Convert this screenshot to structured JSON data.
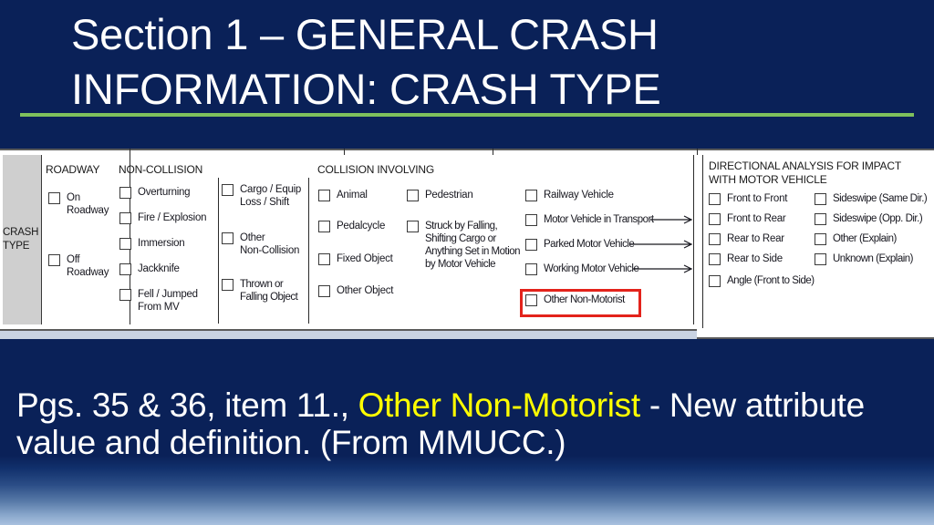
{
  "slide": {
    "background_color": "#0a2158",
    "accent_rule_color": "#7fc15c",
    "highlight_color": "#ffff00",
    "red_box_color": "#e3231b"
  },
  "title": {
    "text": "Section 1 – GENERAL CRASH\nINFORMATION: CRASH TYPE"
  },
  "form": {
    "row_label": "CRASH\nTYPE",
    "sections": {
      "roadway": {
        "heading": "ROADWAY",
        "options": [
          "On\nRoadway",
          "Off\nRoadway"
        ]
      },
      "non_collision": {
        "heading": "NON-COLLISION",
        "options_col1": [
          "Overturning",
          "Fire / Explosion",
          "Immersion",
          "Jackknife",
          "Fell / Jumped\nFrom MV"
        ],
        "options_col2": [
          "Cargo / Equip\nLoss / Shift",
          "Other\nNon-Collision",
          "Thrown or\nFalling Object"
        ]
      },
      "collision_involving": {
        "heading": "COLLISION INVOLVING",
        "options_col1": [
          "Animal",
          "Pedalcycle",
          "Fixed Object",
          "Other Object"
        ],
        "options_col2": [
          "Pedestrian",
          "Struck by Falling,\nShifting Cargo or\nAnything Set in Motion\nby Motor Vehicle"
        ],
        "options_col3": [
          "Railway Vehicle",
          "Motor Vehicle in Transport",
          "Parked Motor Vehicle",
          "Working Motor Vehicle",
          "Other Non-Motorist"
        ],
        "highlighted_option": "Other Non-Motorist"
      },
      "directional_analysis": {
        "heading": "DIRECTIONAL ANALYSIS FOR IMPACT\nWITH MOTOR VEHICLE",
        "options_col1": [
          "Front to Front",
          "Front to Rear",
          "Rear to Rear",
          "Rear to Side",
          "Angle (Front to Side)"
        ],
        "options_col2": [
          "Sideswipe (Same Dir.)",
          "Sideswipe (Opp. Dir.)",
          "Other (Explain)",
          "Unknown (Explain)"
        ]
      }
    }
  },
  "caption": {
    "part1": "Pgs. 35 & 36, item 11., ",
    "highlight": "Other Non-Motorist",
    "part2": " - New attribute value and definition. (From MMUCC.)"
  }
}
